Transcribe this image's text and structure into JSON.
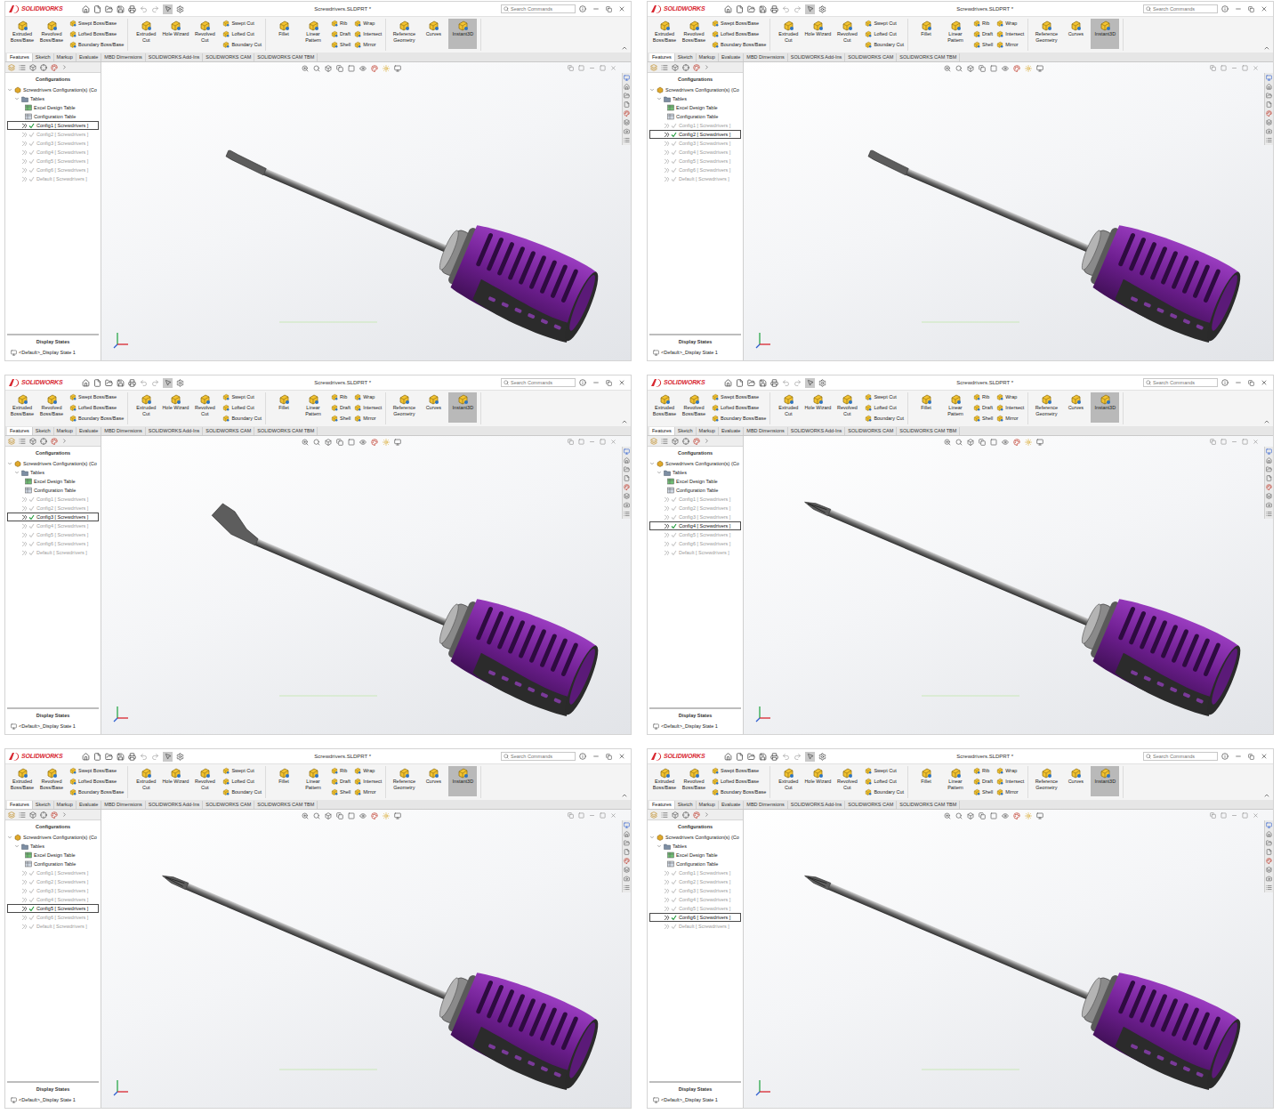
{
  "app": {
    "logo": "SOLIDWORKS"
  },
  "title": "Screwdrivers.SLDPRT *",
  "search": {
    "placeholder": "Search Commands"
  },
  "ribbon": [
    {
      "big": [
        {
          "label": "Extruded Boss/Base",
          "selected": false
        },
        {
          "label": "Revolved Boss/Base",
          "selected": false
        }
      ],
      "stacks": [
        [
          "Swept Boss/Base",
          "Lofted Boss/Base",
          "Boundary Boss/Base"
        ]
      ]
    },
    {
      "big": [
        {
          "label": "Extruded Cut",
          "selected": false
        },
        {
          "label": "Hole Wizard",
          "selected": false
        },
        {
          "label": "Revolved Cut",
          "selected": false
        }
      ],
      "stacks": [
        [
          "Swept Cut",
          "Lofted Cut",
          "Boundary Cut"
        ]
      ]
    },
    {
      "big": [
        {
          "label": "Fillet",
          "selected": false
        },
        {
          "label": "Linear Pattern",
          "selected": false
        }
      ],
      "stacks": [
        [
          "Rib",
          "Draft",
          "Shell"
        ],
        [
          "Wrap",
          "Intersect",
          "Mirror"
        ]
      ]
    },
    {
      "big": [
        {
          "label": "Reference Geometry",
          "selected": false
        },
        {
          "label": "Curves",
          "selected": false
        },
        {
          "label": "Instant3D",
          "selected": true
        }
      ],
      "stacks": []
    }
  ],
  "tabs": [
    {
      "label": "Features",
      "selected": true
    },
    {
      "label": "Sketch",
      "selected": false
    },
    {
      "label": "Markup",
      "selected": false
    },
    {
      "label": "Evaluate",
      "selected": false
    },
    {
      "label": "MBD Dimensions",
      "selected": false
    },
    {
      "label": "SOLIDWORKS Add-Ins",
      "selected": false
    },
    {
      "label": "SOLIDWORKS CAM",
      "selected": false
    },
    {
      "label": "SOLIDWORKS CAM TBM",
      "selected": false
    }
  ],
  "tree": {
    "header": "Configurations",
    "root": "Screwdrivers Configuration(s) (Co",
    "folder": "Tables",
    "tables": [
      "Excel Design Table",
      "Configuration Table"
    ]
  },
  "display_states": {
    "header": "Display States",
    "item": "<Default>_Display State 1"
  },
  "windows": [
    {
      "tip": "flat",
      "configurations": [
        {
          "name": "Config1 [ Screwdrivers ]",
          "selected": true
        },
        {
          "name": "Config2 [ Screwdrivers ]",
          "selected": false
        },
        {
          "name": "Config3 [ Screwdrivers ]",
          "selected": false
        },
        {
          "name": "Config4 [ Screwdrivers ]",
          "selected": false
        },
        {
          "name": "Config5 [ Screwdrivers ]",
          "selected": false
        },
        {
          "name": "Config6 [ Screwdrivers ]",
          "selected": false
        },
        {
          "name": "Default [ Screwdrivers ]",
          "selected": false
        }
      ]
    },
    {
      "tip": "flat",
      "configurations": [
        {
          "name": "Config1 [ Screwdrivers ]",
          "selected": false
        },
        {
          "name": "Config2 [ Screwdrivers ]",
          "selected": true
        },
        {
          "name": "Config3 [ Screwdrivers ]",
          "selected": false
        },
        {
          "name": "Config4 [ Screwdrivers ]",
          "selected": false
        },
        {
          "name": "Config5 [ Screwdrivers ]",
          "selected": false
        },
        {
          "name": "Config6 [ Screwdrivers ]",
          "selected": false
        },
        {
          "name": "Default [ Screwdrivers ]",
          "selected": false
        }
      ]
    },
    {
      "tip": "wide-flat",
      "configurations": [
        {
          "name": "Config1 [ Screwdrivers ]",
          "selected": false
        },
        {
          "name": "Config2 [ Screwdrivers ]",
          "selected": false
        },
        {
          "name": "Config3 [ Screwdrivers ]",
          "selected": true
        },
        {
          "name": "Config4 [ Screwdrivers ]",
          "selected": false
        },
        {
          "name": "Config5 [ Screwdrivers ]",
          "selected": false
        },
        {
          "name": "Config6 [ Screwdrivers ]",
          "selected": false
        },
        {
          "name": "Default [ Screwdrivers ]",
          "selected": false
        }
      ]
    },
    {
      "tip": "phillips",
      "configurations": [
        {
          "name": "Config1 [ Screwdrivers ]",
          "selected": false
        },
        {
          "name": "Config2 [ Screwdrivers ]",
          "selected": false
        },
        {
          "name": "Config3 [ Screwdrivers ]",
          "selected": false
        },
        {
          "name": "Config4 [ Screwdrivers ]",
          "selected": true
        },
        {
          "name": "Config5 [ Screwdrivers ]",
          "selected": false
        },
        {
          "name": "Config6 [ Screwdrivers ]",
          "selected": false
        },
        {
          "name": "Default [ Screwdrivers ]",
          "selected": false
        }
      ]
    },
    {
      "tip": "phillips",
      "configurations": [
        {
          "name": "Config1 [ Screwdrivers ]",
          "selected": false
        },
        {
          "name": "Config2 [ Screwdrivers ]",
          "selected": false
        },
        {
          "name": "Config3 [ Screwdrivers ]",
          "selected": false
        },
        {
          "name": "Config4 [ Screwdrivers ]",
          "selected": false
        },
        {
          "name": "Config5 [ Screwdrivers ]",
          "selected": true
        },
        {
          "name": "Config6 [ Screwdrivers ]",
          "selected": false
        },
        {
          "name": "Default [ Screwdrivers ]",
          "selected": false
        }
      ]
    },
    {
      "tip": "phillips",
      "configurations": [
        {
          "name": "Config1 [ Screwdrivers ]",
          "selected": false
        },
        {
          "name": "Config2 [ Screwdrivers ]",
          "selected": false
        },
        {
          "name": "Config3 [ Screwdrivers ]",
          "selected": false
        },
        {
          "name": "Config4 [ Screwdrivers ]",
          "selected": false
        },
        {
          "name": "Config5 [ Screwdrivers ]",
          "selected": false
        },
        {
          "name": "Config6 [ Screwdrivers ]",
          "selected": true
        },
        {
          "name": "Default [ Screwdrivers ]",
          "selected": false
        }
      ]
    }
  ]
}
